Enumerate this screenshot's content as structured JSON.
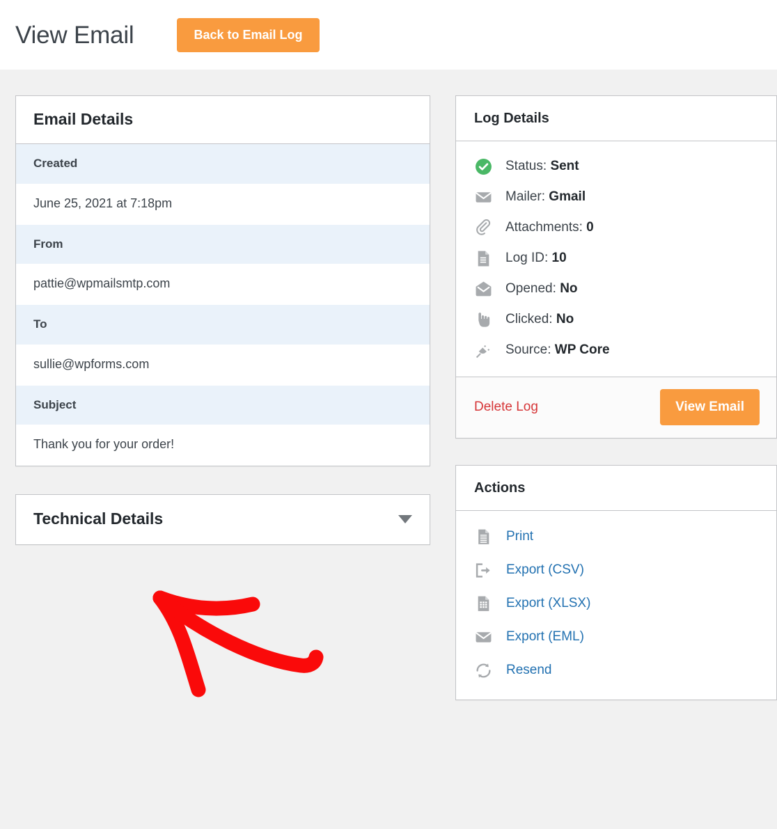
{
  "header": {
    "title": "View Email",
    "back_button": "Back to Email Log"
  },
  "email_details": {
    "title": "Email Details",
    "rows": [
      {
        "label": "Created",
        "value": "June 25, 2021 at 7:18pm"
      },
      {
        "label": "From",
        "value": "pattie@wpmailsmtp.com"
      },
      {
        "label": "To",
        "value": "sullie@wpforms.com"
      },
      {
        "label": "Subject",
        "value": "Thank you for your order!"
      }
    ]
  },
  "technical_details": {
    "title": "Technical Details",
    "toggle_icon": "chevron-down-icon",
    "expanded": false
  },
  "log_details": {
    "title": "Log Details",
    "items": [
      {
        "icon": "check-circle-icon",
        "label": "Status:",
        "value": "Sent"
      },
      {
        "icon": "envelope-closed-icon",
        "label": "Mailer:",
        "value": "Gmail"
      },
      {
        "icon": "paperclip-icon",
        "label": "Attachments:",
        "value": "0"
      },
      {
        "icon": "document-icon",
        "label": "Log ID:",
        "value": "10"
      },
      {
        "icon": "envelope-open-icon",
        "label": "Opened:",
        "value": "No"
      },
      {
        "icon": "pointing-hand-icon",
        "label": "Clicked:",
        "value": "No"
      },
      {
        "icon": "plug-icon",
        "label": "Source:",
        "value": "WP Core"
      }
    ],
    "delete_link": "Delete Log",
    "view_button": "View Email"
  },
  "actions": {
    "title": "Actions",
    "items": [
      {
        "icon": "print-icon",
        "label": "Print"
      },
      {
        "icon": "export-csv-icon",
        "label": "Export (CSV)"
      },
      {
        "icon": "export-xlsx-icon",
        "label": "Export (XLSX)"
      },
      {
        "icon": "export-eml-icon",
        "label": "Export (EML)"
      },
      {
        "icon": "resend-icon",
        "label": "Resend"
      }
    ]
  },
  "annotation": {
    "type": "arrow",
    "color": "#fa0a0a",
    "points_to": "Technical Details"
  },
  "colors": {
    "accent_orange": "#f99b3f",
    "link_blue": "#2271b1",
    "danger_red": "#d63638",
    "status_green": "#4ab866",
    "label_row": "#eaf2fa",
    "page_bg": "#f1f1f1",
    "annotation_red": "#fa0a0a"
  }
}
